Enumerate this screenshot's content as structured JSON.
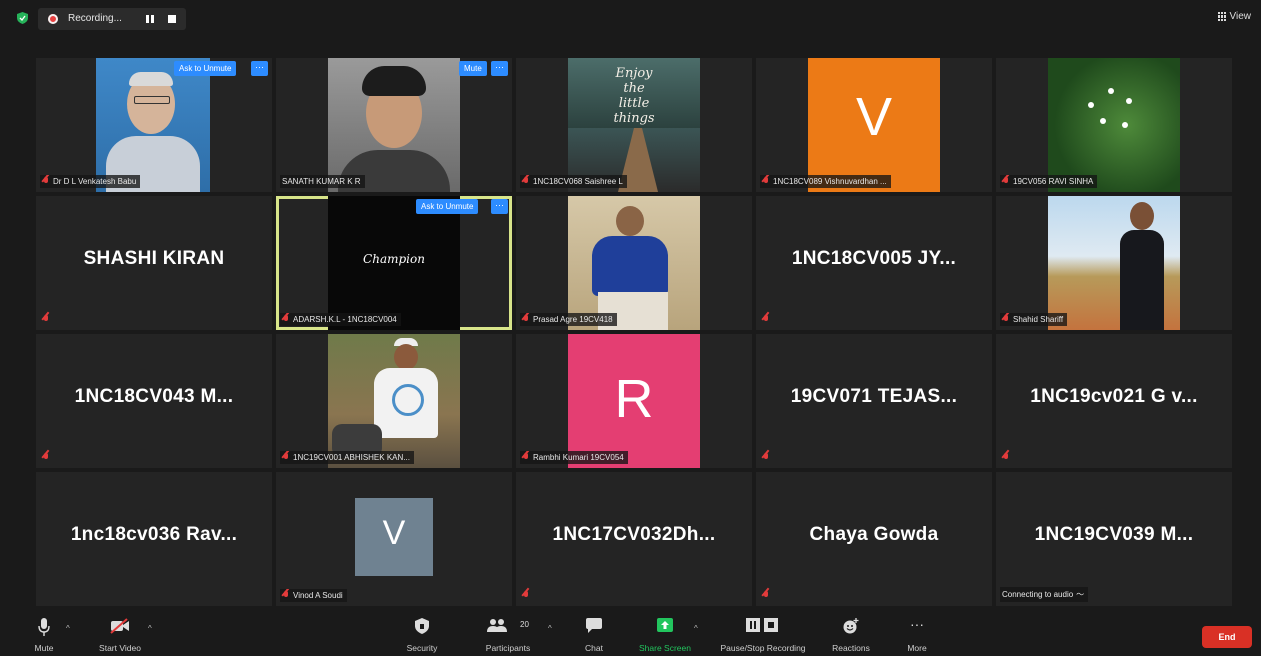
{
  "topbar": {
    "recording_label": "Recording...",
    "view_label": "View"
  },
  "tiles": [
    {
      "name": "Dr D L Venkatesh Babu",
      "button": "Ask to Unmute",
      "more": "···"
    },
    {
      "name": "SANATH KUMAR K R",
      "button": "Mute",
      "more": "···"
    },
    {
      "name": "1NC18CV068 Saishree L",
      "poster": [
        "Enjoy",
        "the",
        "little",
        "things"
      ]
    },
    {
      "name": "1NC18CV089 Vishnuvardhan ...",
      "letter": "V"
    },
    {
      "name": "19CV056 RAVI SINHA"
    },
    {
      "display": "SHASHI KIRAN"
    },
    {
      "name": "ADARSH.K.L - 1NC18CV004",
      "button": "Ask to Unmute",
      "more": "···",
      "logo": "Champion"
    },
    {
      "name": "Prasad Agre 19CV418"
    },
    {
      "display": "1NC18CV005 JY..."
    },
    {
      "name": "Shahid Shariff"
    },
    {
      "display": "1NC18CV043 M..."
    },
    {
      "name": "1NC19CV001 ABHISHEK KAN..."
    },
    {
      "name": "Rambhi Kumari 19CV054",
      "letter": "R"
    },
    {
      "display": "19CV071 TEJAS..."
    },
    {
      "display": "1NC19cv021 G v..."
    },
    {
      "display": "1nc18cv036 Rav..."
    },
    {
      "name": "Vinod A Soudi",
      "letter": "V"
    },
    {
      "display": "1NC17CV032Dh..."
    },
    {
      "display": "Chaya Gowda"
    },
    {
      "display": "1NC19CV039 M...",
      "status": "Connecting to audio"
    }
  ],
  "toolbar": {
    "mute": "Mute",
    "start_video": "Start Video",
    "security": "Security",
    "participants": "Participants",
    "participants_count": "20",
    "chat": "Chat",
    "share_screen": "Share Screen",
    "recording": "Pause/Stop Recording",
    "reactions": "Reactions",
    "more": "More",
    "end": "End"
  },
  "colors": {
    "accent": "#2d8cff",
    "active_border": "#d8e58a",
    "end": "#d93025",
    "share": "#22c55e"
  }
}
